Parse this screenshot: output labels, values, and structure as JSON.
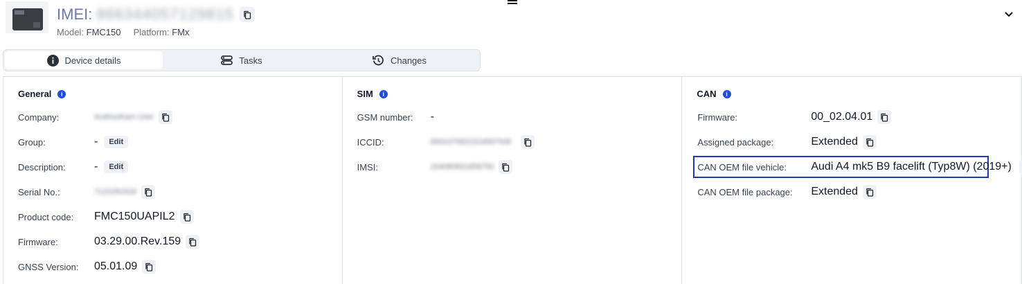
{
  "header": {
    "imei_label": "IMEI:",
    "imei_value": "866344057129815",
    "model_label": "Model:",
    "model_value": "FMC150",
    "platform_label": "Platform:",
    "platform_value": "FMx"
  },
  "tabs": [
    {
      "label": "Device details",
      "icon": "info-icon",
      "active": true
    },
    {
      "label": "Tasks",
      "icon": "tasks-icon",
      "active": false
    },
    {
      "label": "Changes",
      "icon": "history-icon",
      "active": false
    }
  ],
  "general": {
    "title": "General",
    "company_label": "Company:",
    "company_value": "AndriusKam User",
    "group_label": "Group:",
    "group_value": "-",
    "group_edit": "Edit",
    "description_label": "Description:",
    "description_value": "-",
    "description_edit": "Edit",
    "serial_label": "Serial No.:",
    "serial_value": "7122281918",
    "product_label": "Product code:",
    "product_value": "FMC150UAPIL2",
    "firmware_label": "Firmware:",
    "firmware_value": "03.29.00.Rev.159",
    "gnss_label": "GNSS Version:",
    "gnss_value": "05.01.09"
  },
  "sim": {
    "title": "SIM",
    "gsm_label": "GSM number:",
    "gsm_value": "-",
    "iccid_label": "ICCID:",
    "iccid_value": "8931070822319587508",
    "imsi_label": "IMSI:",
    "imsi_value": "204080831858750"
  },
  "can": {
    "title": "CAN",
    "firmware_label": "Firmware:",
    "firmware_value": "00_02.04.01",
    "package_label": "Assigned package:",
    "package_value": "Extended",
    "oem_vehicle_label": "CAN OEM file vehicle:",
    "oem_vehicle_value": "Audi A4 mk5 B9 facelift (Typ8W) (2019+)",
    "oem_package_label": "CAN OEM file package:",
    "oem_package_value": "Extended"
  }
}
